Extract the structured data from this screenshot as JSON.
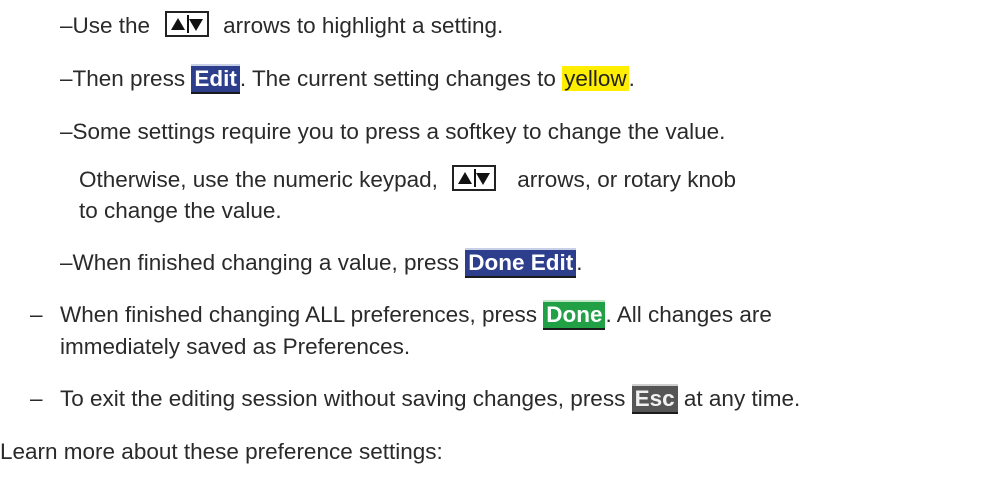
{
  "lines": {
    "l1": {
      "dash": "–",
      "pre": "Use the",
      "post": "arrows to highlight a setting."
    },
    "l2": {
      "dash": "–",
      "pre": "Then press",
      "key": "Edit",
      "mid": ". The current setting changes to",
      "hl": "yellow",
      "post": "."
    },
    "l3": {
      "dash": "–",
      "text": "Some settings require you to press a softkey to change the value."
    },
    "l4": {
      "pre": "Otherwise, use the numeric keypad,",
      "post": "arrows, or rotary knob"
    },
    "l5": {
      "text": "to change the value."
    },
    "l6": {
      "dash": "–",
      "pre": "When finished changing a value, press",
      "key": "Done Edit",
      "post": "."
    },
    "l7": {
      "dash": "–",
      "pre": "When finished changing ALL preferences, press",
      "key": "Done",
      "post": ". All changes are"
    },
    "l8": {
      "text": "immediately saved as Preferences."
    },
    "l9": {
      "dash": "–",
      "pre": "To exit the editing session without saving changes, press",
      "key": "Esc",
      "post": "at any time."
    },
    "l10": {
      "text": "Learn more about these preference settings:"
    }
  },
  "icons": {
    "updown": "up-down-arrow-keys-icon"
  },
  "colors": {
    "key_blue": "#2d3f8c",
    "key_green": "#22a046",
    "key_gray": "#555555",
    "highlight_yellow": "#ffee00"
  }
}
